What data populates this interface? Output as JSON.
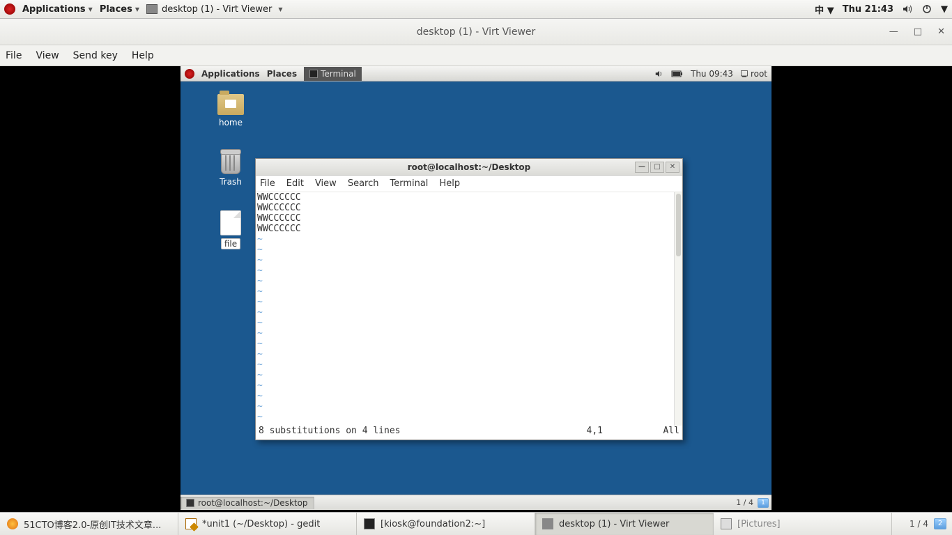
{
  "host_panel": {
    "applications": "Applications",
    "places": "Places",
    "task_label": "desktop (1) - Virt Viewer",
    "ime": "中",
    "clock": "Thu 21:43"
  },
  "virt_viewer": {
    "title": "desktop (1) - Virt Viewer",
    "menu": {
      "file": "File",
      "view": "View",
      "sendkey": "Send key",
      "help": "Help"
    }
  },
  "guest_panel": {
    "applications": "Applications",
    "places": "Places",
    "terminal": "Terminal",
    "clock": "Thu 09:43",
    "user": "root"
  },
  "guest_icons": {
    "home": "home",
    "trash": "Trash",
    "file": "file"
  },
  "terminal": {
    "title": "root@localhost:~/Desktop",
    "menu": {
      "file": "File",
      "edit": "Edit",
      "view": "View",
      "search": "Search",
      "terminal": "Terminal",
      "help": "Help"
    },
    "lines": [
      "WWCCCCCC",
      "WWCCCCCC",
      "WWCCCCCC",
      "WWCCCCCC"
    ],
    "status_left": "8 substitutions on 4 lines",
    "status_pos": "4,1",
    "status_pct": "All"
  },
  "guest_bottombar": {
    "task": "root@localhost:~/Desktop",
    "pager": "1 / 4"
  },
  "host_bottombar": {
    "tasks": [
      {
        "label": "51CTO博客2.0-原创IT技术文章...",
        "icon": "ff"
      },
      {
        "label": "*unit1 (~/Desktop) - gedit",
        "icon": "gedit"
      },
      {
        "label": "[kiosk@foundation2:~]",
        "icon": "term"
      },
      {
        "label": "desktop (1) - Virt Viewer",
        "icon": "win",
        "active": true
      },
      {
        "label": "[Pictures]",
        "icon": "folder",
        "dim": true
      }
    ],
    "pager": "1 / 4"
  }
}
